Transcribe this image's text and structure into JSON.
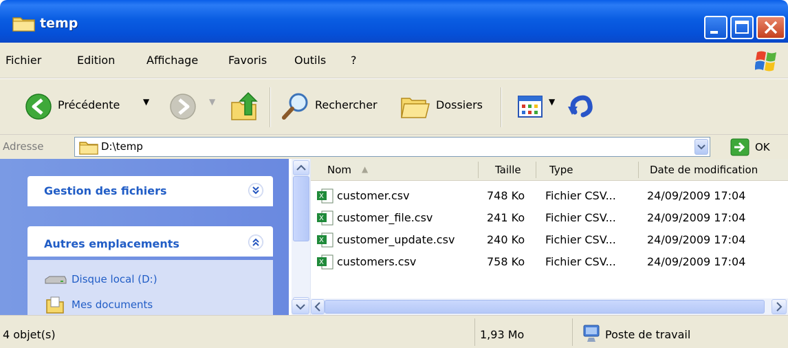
{
  "window": {
    "title": "temp",
    "min_label": "minimize",
    "max_label": "maximize",
    "close_label": "close"
  },
  "menu": {
    "items": [
      "Fichier",
      "Edition",
      "Affichage",
      "Favoris",
      "Outils",
      "?"
    ]
  },
  "toolbar": {
    "back_label": "Précédente",
    "search_label": "Rechercher",
    "folders_label": "Dossiers"
  },
  "address": {
    "label": "Adresse",
    "value": "D:\\temp",
    "go_label": "OK"
  },
  "tasks": {
    "file_group_title": "Gestion des fichiers",
    "other_group_title": "Autres emplacements",
    "places": [
      "Disque local (D:)",
      "Mes documents"
    ]
  },
  "columns": {
    "name": "Nom",
    "size": "Taille",
    "type": "Type",
    "date": "Date de modification"
  },
  "files": [
    {
      "name": "customer.csv",
      "size": "748 Ko",
      "type": "Fichier CSV...",
      "date": "24/09/2009 17:04"
    },
    {
      "name": "customer_file.csv",
      "size": "241 Ko",
      "type": "Fichier CSV...",
      "date": "24/09/2009 17:04"
    },
    {
      "name": "customer_update.csv",
      "size": "240 Ko",
      "type": "Fichier CSV...",
      "date": "24/09/2009 17:04"
    },
    {
      "name": "customers.csv",
      "size": "758 Ko",
      "type": "Fichier CSV...",
      "date": "24/09/2009 17:04"
    }
  ],
  "status": {
    "count": "4 objet(s)",
    "total_size": "1,93 Mo",
    "location": "Poste de travail"
  },
  "colors": {
    "titlebar": "#0a5de2",
    "task_pane": "#6a89e0",
    "link": "#215dc6",
    "chrome": "#ece9d8"
  }
}
